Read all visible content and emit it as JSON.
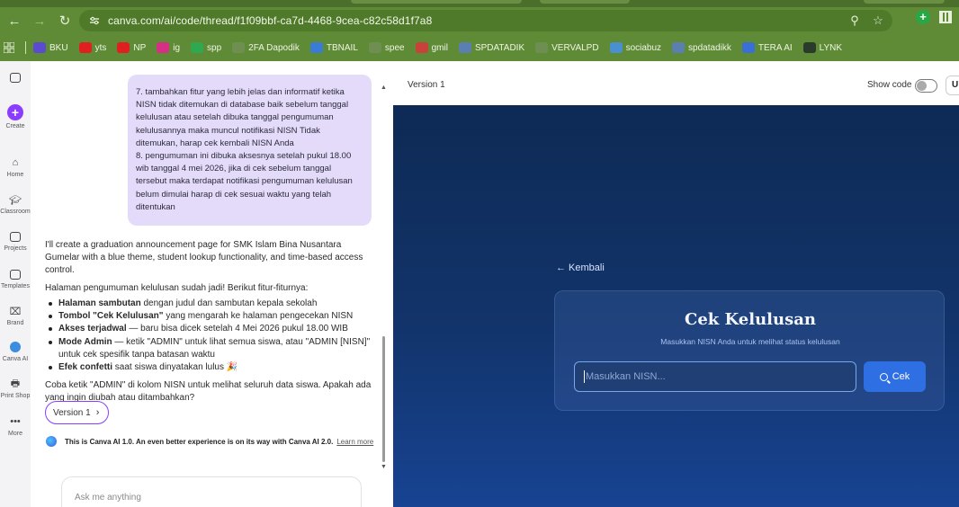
{
  "browser": {
    "url": "canva.com/ai/code/thread/f1f09bbf-ca7d-4468-9cea-c82c58d1f7a8",
    "bookmarks": [
      {
        "label": "BKU",
        "color": "#5b4bd1"
      },
      {
        "label": "yts",
        "color": "#e02020"
      },
      {
        "label": "NP",
        "color": "#e02020"
      },
      {
        "label": "ig",
        "color": "#d62f86"
      },
      {
        "label": "spp",
        "color": "#2fa84f"
      },
      {
        "label": "2FA Dapodik",
        "color": "#6f8f52"
      },
      {
        "label": "TBNAIL",
        "color": "#3a7bd5"
      },
      {
        "label": "spee",
        "color": "#6f8f52"
      },
      {
        "label": "gmil",
        "color": "#c7423a"
      },
      {
        "label": "SPDATADIK",
        "color": "#5a7fb0"
      },
      {
        "label": "VERVALPD",
        "color": "#6f8f52"
      },
      {
        "label": "sociabuz",
        "color": "#4a8fd0"
      },
      {
        "label": "spdatadikk",
        "color": "#5a7fb0"
      },
      {
        "label": "TERA AI",
        "color": "#3a6fd5"
      },
      {
        "label": "LYNK",
        "color": "#2b3b2b"
      }
    ]
  },
  "rail": {
    "items": [
      {
        "label": "Create"
      },
      {
        "label": "Home"
      },
      {
        "label": "Classroom"
      },
      {
        "label": "Projects"
      },
      {
        "label": "Templates"
      },
      {
        "label": "Brand"
      },
      {
        "label": "Canva AI"
      },
      {
        "label": "Print Shop"
      },
      {
        "label": "More"
      }
    ]
  },
  "chat": {
    "user_message": [
      "7.   tambahkan fitur yang lebih jelas dan informatif ketika NISN tidak ditemukan di database baik sebelum tanggal kelulusan atau setelah dibuka tanggal pengumuman kelulusannya maka muncul notifikasi NISN Tidak ditemukan, harap cek kembali NISN Anda",
      "8.   pengumuman ini dibuka aksesnya setelah pukul 18.00 wib tanggal 4 mei 2026, jika di cek sebelum tanggal tersebut maka terdapat notifikasi pengumuman kelulusan belum dimulai harap di cek sesuai waktu yang telah ditentukan"
    ],
    "reply_intro": "I'll create a graduation announcement page for SMK Islam Bina Nusantara Gumelar with a blue theme, student lookup functionality, and time-based access control.",
    "reply_lead": "Halaman pengumuman kelulusan sudah jadi! Berikut fitur-fiturnya:",
    "features": [
      {
        "bold": "Halaman sambutan",
        "text": " dengan judul dan sambutan kepala sekolah"
      },
      {
        "bold": "Tombol \"Cek Kelulusan\"",
        "text": " yang mengarah ke halaman pengecekan NISN"
      },
      {
        "bold": "Akses terjadwal",
        "text": " — baru bisa dicek setelah 4 Mei 2026 pukul 18.00 WIB"
      },
      {
        "bold": "Mode Admin",
        "text": " — ketik \"ADMIN\" untuk lihat semua siswa, atau \"ADMIN [NISN]\" untuk cek spesifik tanpa batasan waktu"
      },
      {
        "bold": "Efek confetti",
        "text": " saat siswa dinyatakan lulus 🎉"
      }
    ],
    "reply_outro": "Coba ketik \"ADMIN\" di kolom NISN untuk melihat seluruh data siswa. Apakah ada yang ingin diubah atau ditambahkan?",
    "version_pill": "Version 1",
    "notice": "This is Canva AI 1.0. An even better experience is on its way with Canva AI 2.0.",
    "notice_link": "Learn more",
    "ask_placeholder": "Ask me anything"
  },
  "preview": {
    "version_label": "Version 1",
    "show_code_label": "Show code",
    "show_code_on": false,
    "cut_label": "U",
    "back_label": "← Kembali",
    "card_title": "Cek Kelulusan",
    "card_subtitle": "Masukkan NISN Anda untuk melihat status kelulusan",
    "input_placeholder": "Masukkan NISN...",
    "check_button": "Cek",
    "colors": {
      "background_top": "#0e2a55",
      "background_bottom": "#174392",
      "button": "#2f6fe4"
    }
  }
}
